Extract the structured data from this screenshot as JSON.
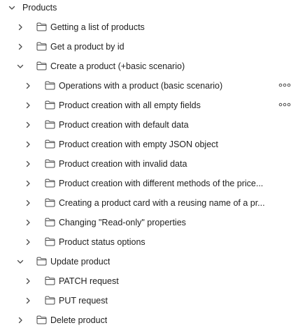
{
  "tree": {
    "root": {
      "label": "Products",
      "expanded": true
    },
    "items": [
      {
        "label": "Getting a list of products",
        "expanded": false
      },
      {
        "label": "Get a product by id",
        "expanded": false
      },
      {
        "label": "Create a product (+basic scenario)",
        "expanded": true,
        "children": [
          {
            "label": "Operations with a product (basic scenario)",
            "expanded": false,
            "more_icon": "more-horizontal-icon"
          },
          {
            "label": "Product creation with all empty fields",
            "expanded": false,
            "more_icon": "more-horizontal-icon"
          },
          {
            "label": "Product creation with default data",
            "expanded": false
          },
          {
            "label": "Product creation with empty JSON object",
            "expanded": false
          },
          {
            "label": "Product creation with invalid data",
            "expanded": false
          },
          {
            "label": "Product creation with different methods of the price...",
            "expanded": false
          },
          {
            "label": "Creating a product card with a reusing name of a pr...",
            "expanded": false
          },
          {
            "label": "Changing \"Read-only\" properties",
            "expanded": false
          },
          {
            "label": "Product status options",
            "expanded": false
          }
        ]
      },
      {
        "label": "Update product",
        "expanded": true,
        "children": [
          {
            "label": "PATCH request",
            "expanded": false
          },
          {
            "label": "PUT request",
            "expanded": false
          }
        ]
      },
      {
        "label": "Delete product",
        "expanded": false
      }
    ]
  },
  "colors": {
    "text": "#212121",
    "icon": "#4a4a4a",
    "background": "#ffffff"
  }
}
